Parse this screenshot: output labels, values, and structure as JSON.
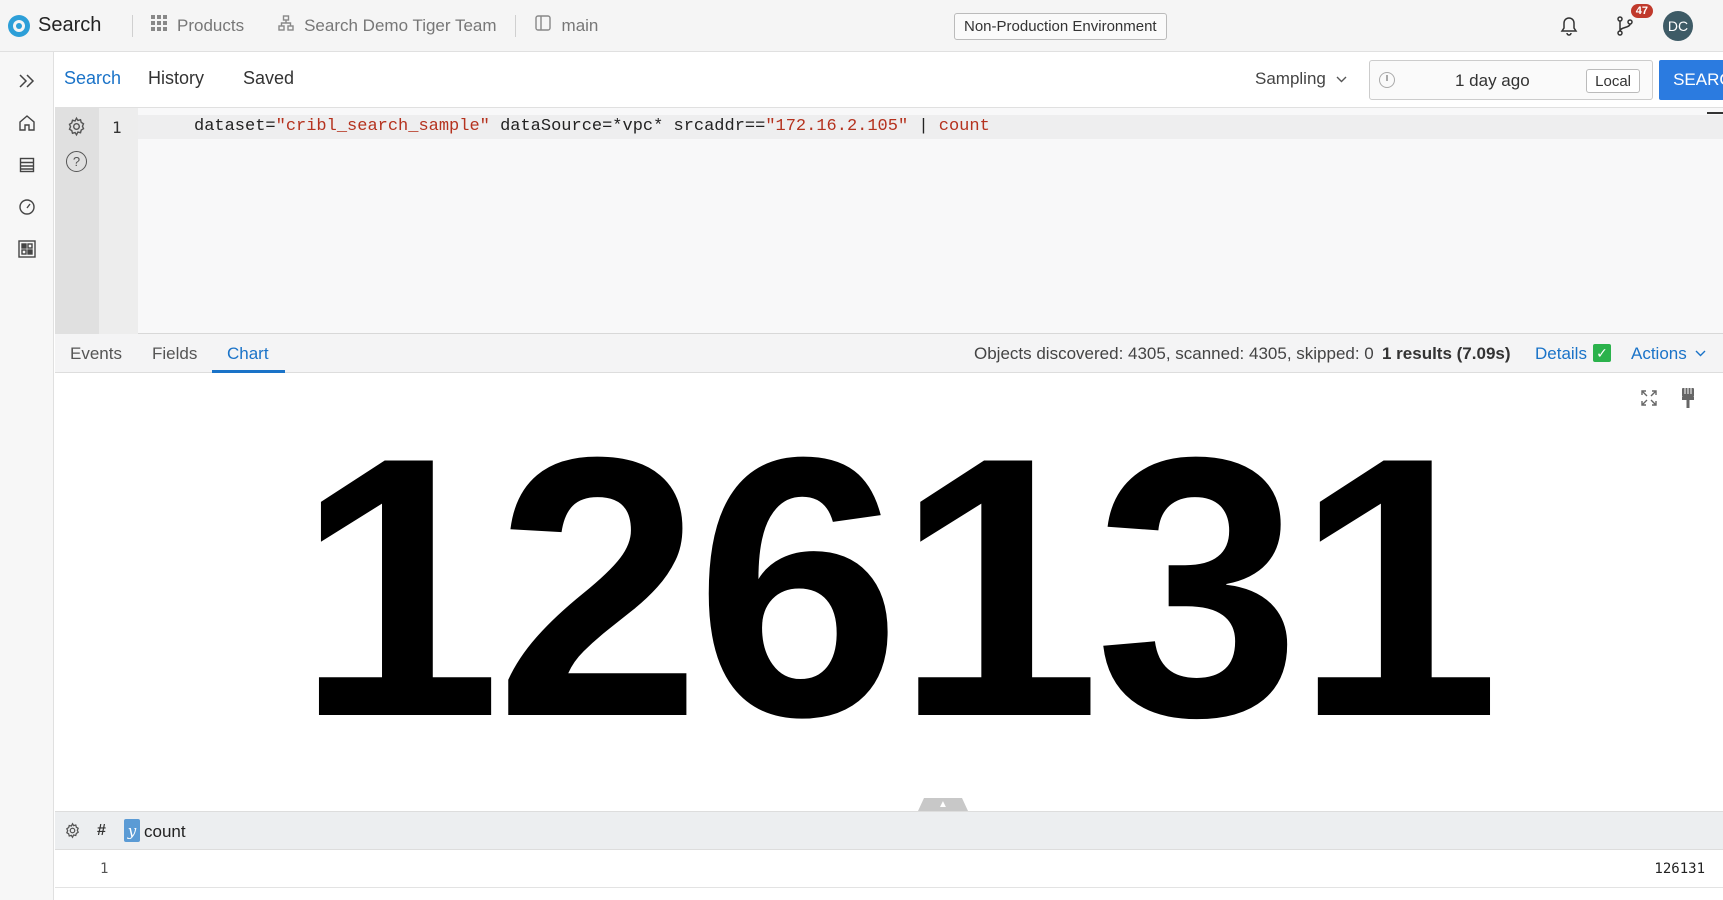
{
  "topbar": {
    "brand": "Search",
    "nav": [
      {
        "label": "Products",
        "icon": "grid-icon"
      },
      {
        "label": "Search Demo Tiger Team",
        "icon": "org-chart-icon"
      },
      {
        "label": "main",
        "icon": "branch-icon"
      }
    ],
    "environment": "Non-Production Environment",
    "notifications_icon": "bell-icon",
    "git_icon": "git-branch-icon",
    "git_badge": "47",
    "avatar": "DC"
  },
  "search": {
    "tabs": [
      "Search",
      "History",
      "Saved"
    ],
    "active_tab": "Search",
    "sampling_label": "Sampling",
    "time_value": "1 day ago",
    "timezone": "Local",
    "search_button": "SEARCH"
  },
  "editor": {
    "line_number": "1",
    "query": [
      {
        "t": "dataset=",
        "c": "plain"
      },
      {
        "t": "\"cribl_search_sample\"",
        "c": "str"
      },
      {
        "t": " dataSource=*vpc* srcaddr==",
        "c": "plain"
      },
      {
        "t": "\"172.16.2.105\"",
        "c": "str"
      },
      {
        "t": " | ",
        "c": "plain"
      },
      {
        "t": "count",
        "c": "kw"
      }
    ]
  },
  "results": {
    "tabs": [
      "Events",
      "Fields",
      "Chart"
    ],
    "active_tab": "Chart",
    "stats": "Objects discovered: 4305, scanned: 4305, skipped: 0",
    "count": "1 results (7.09s)",
    "details": "Details",
    "actions": "Actions"
  },
  "chart": {
    "value": "126131"
  },
  "table": {
    "hash": "#",
    "type_badge": "y",
    "column": "count",
    "rows": [
      {
        "num": "1",
        "count": "126131"
      }
    ]
  },
  "colors": {
    "accent": "#2b7be0",
    "link": "#1a73c8",
    "string_token": "#b5321e",
    "success": "#2bb24c",
    "badge": "#c0392b"
  }
}
